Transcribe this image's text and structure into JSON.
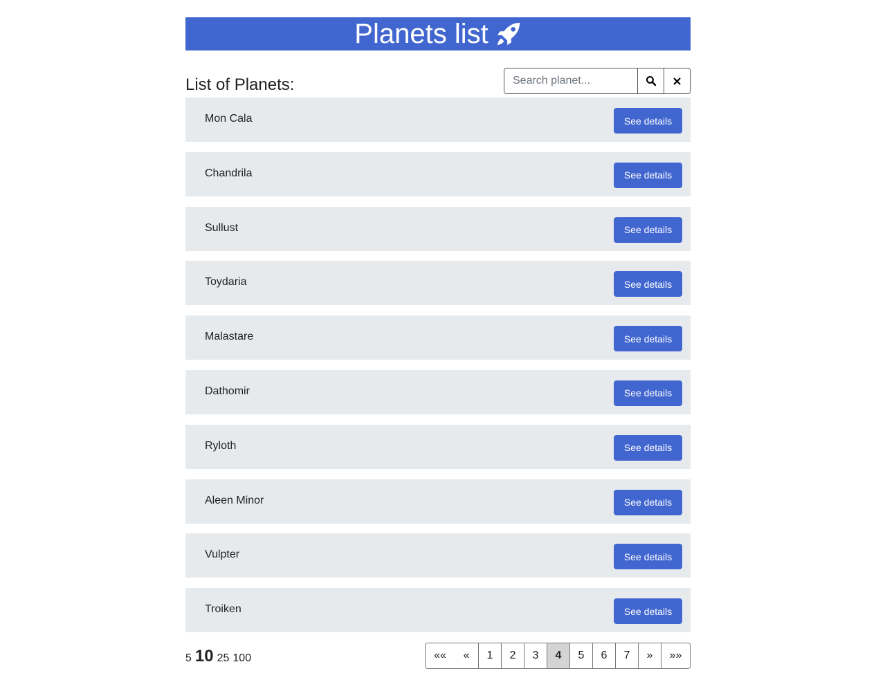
{
  "header": {
    "title": "Planets list",
    "icon": "rocket-icon",
    "background": "#4166cf"
  },
  "toolbar": {
    "subtitle": "List of Planets:",
    "search": {
      "placeholder": "Search planet...",
      "value": "",
      "search_icon": "search-icon",
      "clear_icon": "close-icon"
    }
  },
  "planets": [
    {
      "name": "Mon Cala",
      "button": "See details"
    },
    {
      "name": "Chandrila",
      "button": "See details"
    },
    {
      "name": "Sullust",
      "button": "See details"
    },
    {
      "name": "Toydaria",
      "button": "See details"
    },
    {
      "name": "Malastare",
      "button": "See details"
    },
    {
      "name": "Dathomir",
      "button": "See details"
    },
    {
      "name": "Ryloth",
      "button": "See details"
    },
    {
      "name": "Aleen Minor",
      "button": "See details"
    },
    {
      "name": "Vulpter",
      "button": "See details"
    },
    {
      "name": "Troiken",
      "button": "See details"
    }
  ],
  "page_sizes": {
    "options": [
      "5",
      "10",
      "25",
      "100"
    ],
    "selected": "10"
  },
  "pagination": {
    "first": "««",
    "prev": "«",
    "pages": [
      "1",
      "2",
      "3",
      "4",
      "5",
      "6",
      "7"
    ],
    "current": "4",
    "next": "»",
    "last": "»»"
  },
  "colors": {
    "accent": "#4166cf",
    "row_background": "#e7eaed",
    "active_page": "#d4d4d4"
  }
}
